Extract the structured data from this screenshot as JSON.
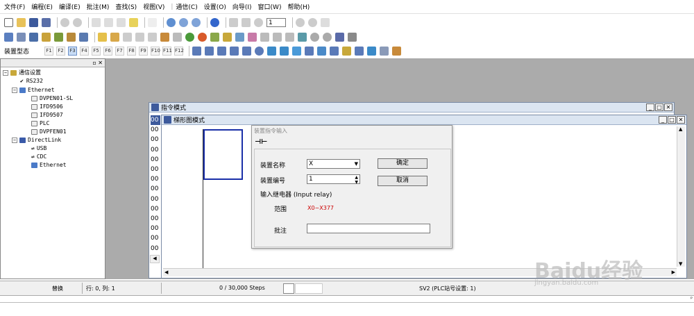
{
  "menu": [
    "文件(F)",
    "编程(E)",
    "编译(E)",
    "批注(M)",
    "查找(S)",
    "视图(V)",
    "通信(C)",
    "设置(O)",
    "向导(I)",
    "窗口(W)",
    "帮助(H)"
  ],
  "toolbar": {
    "counter_value": "1"
  },
  "toolbar3": {
    "label": "装置型态",
    "fkeys": [
      "F1",
      "F2",
      "F3",
      "F4",
      "F5",
      "F6",
      "F7",
      "F8",
      "F9",
      "F10",
      "F11",
      "F12"
    ]
  },
  "tree": {
    "root": "通信设置",
    "rs232": "RS232",
    "ethernet": "Ethernet",
    "eth_children": [
      "DVPEN01-SL",
      "IFD9506",
      "IFD9507",
      "PLC",
      "DVPFEN01"
    ],
    "directlink": "DirectLink",
    "dl_children": [
      "USB",
      "CDC",
      "Ethernet"
    ]
  },
  "windows": {
    "instruction_mode": "指令模式",
    "ladder_mode": "梯形图模式",
    "row_prefix": "00"
  },
  "dialog": {
    "title": "装置指令输入",
    "device_name_label": "装置名称",
    "device_name_value": "X",
    "device_number_label": "装置编号",
    "device_number_value": "1",
    "relay_desc": "输入继电器 (Input relay)",
    "range_label": "范围",
    "range_value": "X0~X377",
    "comment_label": "批注",
    "comment_value": "",
    "ok": "确定",
    "cancel": "取消"
  },
  "status": {
    "mode": "替换",
    "position": "行: 0, 列: 1",
    "steps": "0 / 30,000 Steps",
    "plc": "SV2 (PLC站号设置: 1)"
  },
  "watermark": {
    "logo": "Baidu经验",
    "url": "jingyan.baidu.com"
  },
  "colors": {
    "accent": "#3366cc",
    "range_red": "#cc0000"
  }
}
